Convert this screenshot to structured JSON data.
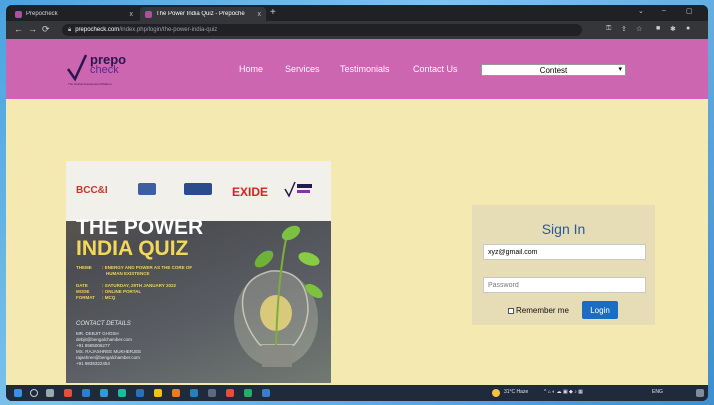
{
  "browser": {
    "tabs": [
      {
        "title": "Prepocheck"
      },
      {
        "title": "The Power India Quiz - Prepoche"
      }
    ],
    "new_tab": "+",
    "tab_close": "x",
    "url_host": "prepocheck.com",
    "url_path": "/index.php/login/the-power-india-quiz"
  },
  "site": {
    "logo_top": "prepo",
    "logo_bottom": "check",
    "logo_tagline": "The Global Assessment Platform",
    "nav": [
      "Home",
      "Services",
      "Testimonials",
      "Contact Us"
    ],
    "contest_select": "Contest"
  },
  "poster": {
    "logos": [
      "BCC&I",
      "EXIDE"
    ],
    "title_line1": "THE POWER",
    "title_line2": "INDIA QUIZ",
    "theme_label": "THEME",
    "theme_text": ": ENERGY AND POWER AS THE CORE OF",
    "theme_text2": "HUMAN EXISTENCE",
    "date_label": "DATE",
    "date_value": ": SATURDAY, 29TH JANUARY 2022",
    "mode_label": "MODE",
    "mode_value": ": ONLINE PORTAL",
    "format_label": "FORMAT",
    "format_value": ": MCQ",
    "contact_heading": "CONTACT DETAILS",
    "contact_lines": [
      "MR. DEBJIT GHOSH",
      "debjit@bengalchamber.com",
      "+91 8585006277",
      "MS. RAJASHREE MUKHERJEE",
      "rajashree@bengalchamber.com",
      "+91 9836322454"
    ]
  },
  "signin": {
    "title": "Sign In",
    "email_value": "xyz@gmail.com",
    "password_placeholder": "Password",
    "remember_label": "Remember me",
    "login_button": "Login"
  },
  "taskbar": {
    "weather": "31°C Haze",
    "lang": "ENG"
  }
}
